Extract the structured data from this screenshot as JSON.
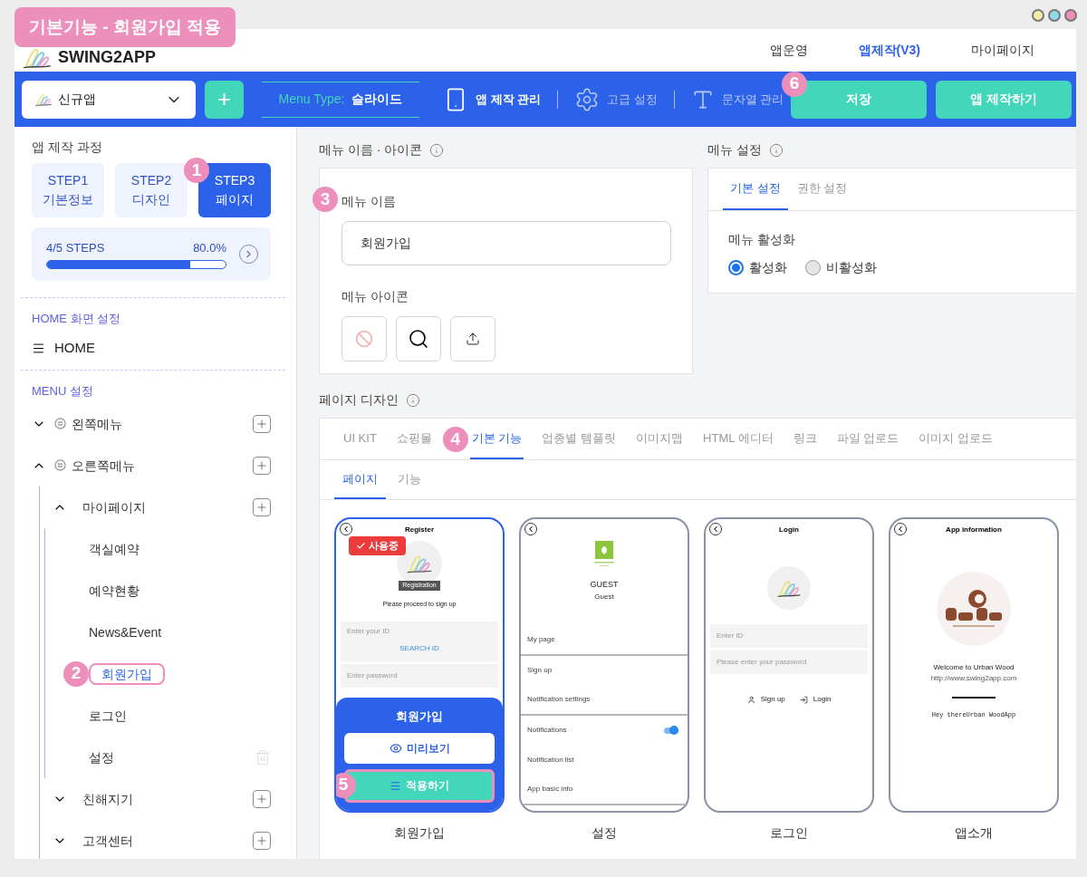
{
  "annotation_title": "기본기능 - 회원가입 적용",
  "header": {
    "logo": "SWING2APP",
    "nav": [
      {
        "label": "앱운영",
        "selected": false
      },
      {
        "label": "앱제작(V3)",
        "selected": true
      },
      {
        "label": "마이페이지",
        "selected": false
      }
    ]
  },
  "toolbar": {
    "app_select": "신규앱",
    "add_button": "+",
    "menu_type_label": "Menu Type:",
    "menu_type_value": "슬라이드",
    "tools": [
      {
        "label": "앱 제작 관리",
        "kind": "phone",
        "selected": true
      },
      {
        "label": "고급 설정",
        "kind": "gear",
        "selected": false
      },
      {
        "label": "문자열 관리",
        "kind": "text",
        "selected": false
      }
    ],
    "buttons": [
      {
        "label": "저장",
        "marker": "6"
      },
      {
        "label": "앱 제작하기"
      }
    ]
  },
  "sidebar": {
    "process_title": "앱 제작 과정",
    "steps": [
      {
        "label": "STEP1",
        "sub": "기본정보",
        "selected": false
      },
      {
        "label": "STEP2",
        "sub": "디자인",
        "selected": false
      },
      {
        "label": "STEP3",
        "sub": "페이지",
        "selected": true,
        "marker": "1"
      }
    ],
    "progress": {
      "label": "4/5 STEPS",
      "percent": "80.0%",
      "level": 0.8
    },
    "home_title": "HOME 화면 설정",
    "home_item": "HOME",
    "menu_title": "MENU 설정",
    "menu_tree": [
      {
        "label": "왼쪽메뉴",
        "expanded": false,
        "can_add": true,
        "selected": false
      },
      {
        "label": "오른쪽메뉴",
        "expanded": true,
        "can_add": true,
        "selected": false,
        "children": [
          {
            "label": "마이페이지",
            "expanded": true,
            "can_add": true,
            "selected": false,
            "children": [
              {
                "label": "객실예약",
                "selected": false
              },
              {
                "label": "예약현황",
                "selected": false
              },
              {
                "label": "News&Event",
                "selected": false
              },
              {
                "label": "회원가입",
                "selected": true,
                "marker": "2"
              },
              {
                "label": "로그인",
                "selected": false
              },
              {
                "label": "설정",
                "selected": false,
                "can_delete": true
              }
            ]
          },
          {
            "label": "친해지기",
            "expanded": false,
            "can_add": true,
            "selected": false
          },
          {
            "label": "고객센터",
            "expanded": false,
            "can_add": true,
            "selected": false
          }
        ]
      }
    ]
  },
  "menu_name_panel": {
    "title": "메뉴 이름 · 아이콘",
    "name_label": "메뉴 이름",
    "name_marker": "3",
    "name_value": "회원가입",
    "icon_label": "메뉴 아이콘",
    "icon_buttons": [
      {
        "kind": "none"
      },
      {
        "kind": "search"
      },
      {
        "kind": "upload"
      }
    ]
  },
  "menu_settings": {
    "title": "메뉴 설정",
    "tabs": [
      {
        "label": "기본 설정",
        "selected": true
      },
      {
        "label": "권한 설정",
        "selected": false
      }
    ],
    "activation_label": "메뉴 활성화",
    "options": [
      {
        "label": "활성화",
        "selected": true
      },
      {
        "label": "비활성화",
        "selected": false
      }
    ]
  },
  "page_design": {
    "title": "페이지 디자인",
    "tabs": [
      {
        "label": "UI KIT",
        "selected": false
      },
      {
        "label": "쇼핑몰",
        "selected": false
      },
      {
        "label": "기본 기능",
        "selected": true,
        "marker": "4"
      },
      {
        "label": "업종별 템플릿",
        "selected": false
      },
      {
        "label": "이미지맵",
        "selected": false
      },
      {
        "label": "HTML 에디터",
        "selected": false
      },
      {
        "label": "링크",
        "selected": false
      },
      {
        "label": "파일 업로드",
        "selected": false
      },
      {
        "label": "이미지 업로드",
        "selected": false
      }
    ],
    "subtabs": [
      {
        "label": "페이지",
        "selected": true
      },
      {
        "label": "기능",
        "selected": false
      }
    ],
    "templates": [
      {
        "kind": "register",
        "name": "회원가입",
        "selected": true,
        "title": "Register",
        "badge": "사용중",
        "avatar_label": "Registration",
        "message": "Please proceed to sign up",
        "id_placeholder": "Enter your ID",
        "search_link": "SEARCH ID",
        "password_placeholder": "Enter password",
        "overlay": {
          "title": "회원가입",
          "preview": "미리보기",
          "apply": "적용하기",
          "apply_marker": "5"
        }
      },
      {
        "kind": "settings",
        "name": "설정",
        "selected": false,
        "user": "GUEST",
        "user_sub": "Guest",
        "items": [
          {
            "label": "My page",
            "divider": true
          },
          {
            "label": "Sign up",
            "divider": false
          },
          {
            "label": "Notification settings",
            "divider": true
          },
          {
            "label": "Notifications",
            "divider": false,
            "toggle": true
          },
          {
            "label": "Notification list",
            "divider": false
          },
          {
            "label": "App basic info",
            "divider": true
          }
        ]
      },
      {
        "kind": "login",
        "name": "로그인",
        "selected": false,
        "title": "Login",
        "id_placeholder": "Enter ID",
        "password_placeholder": "Please enter your password",
        "links": [
          "Sign up",
          "Login"
        ]
      },
      {
        "kind": "about",
        "name": "앱소개",
        "selected": false,
        "title": "App information",
        "welcome": "Welcome to Urban Wood",
        "url": "http://www.swing2app.com",
        "note": "Hey thereUrban WoodApp"
      }
    ]
  }
}
